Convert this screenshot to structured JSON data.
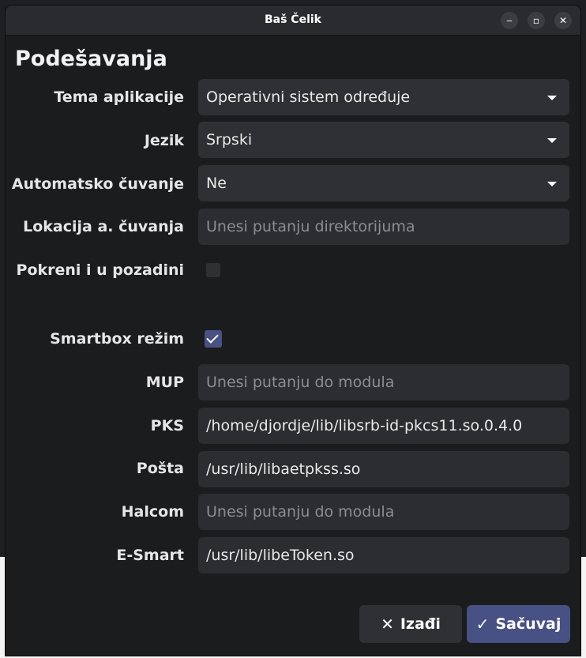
{
  "window": {
    "title": "Baš Čelik"
  },
  "page": {
    "heading": "Podešavanja"
  },
  "settings": {
    "theme": {
      "label": "Tema aplikacije",
      "value": "Operativni sistem određuje"
    },
    "language": {
      "label": "Jezik",
      "value": "Srpski"
    },
    "autosave": {
      "label": "Automatsko čuvanje",
      "value": "Ne"
    },
    "autosave_location": {
      "label": "Lokacija a. čuvanja",
      "placeholder": "Unesi putanju direktorijuma"
    },
    "background": {
      "label": "Pokreni i u pozadini",
      "checked": false
    },
    "smartbox": {
      "label": "Smartbox režim",
      "checked": true
    },
    "mup": {
      "label": "MUP",
      "placeholder": "Unesi putanju do modula",
      "value": ""
    },
    "pks": {
      "label": "PKS",
      "value": "/home/djordje/lib/libsrb-id-pkcs11.so.0.4.0"
    },
    "posta": {
      "label": "Pošta",
      "value": "/usr/lib/libaetpkss.so"
    },
    "halcom": {
      "label": "Halcom",
      "placeholder": "Unesi putanju do modula",
      "value": ""
    },
    "esmart": {
      "label": "E-Smart",
      "value": "/usr/lib/libeToken.so"
    }
  },
  "buttons": {
    "quit_label": "Izađi",
    "save_label": "Sačuvaj"
  },
  "icons": {
    "minimize": "minimize-icon",
    "maximize": "maximize-icon",
    "close": "close-icon",
    "dropdown": "chevron-down-icon",
    "quit": "x-icon",
    "save": "check-icon"
  },
  "colors": {
    "accent": "#485184",
    "window_bg": "#1b1c1e",
    "field_bg": "#2f3033"
  }
}
